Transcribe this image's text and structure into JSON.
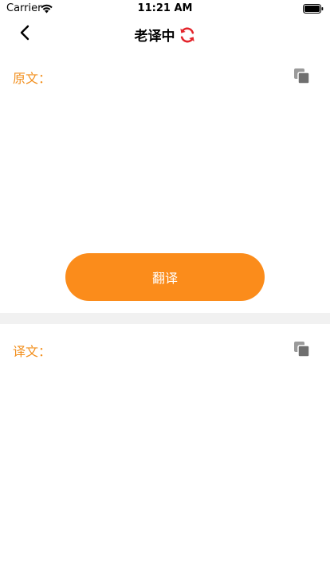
{
  "status_bar": {
    "carrier": "Carrier",
    "time": "11:21 AM"
  },
  "nav": {
    "title": "老译中",
    "refresh_icon_color": "#e3242b"
  },
  "source": {
    "label": "原文：",
    "text": ""
  },
  "translate_button": {
    "label": "翻译",
    "color": "#fb8c1b"
  },
  "result": {
    "label": "译文：",
    "text": ""
  },
  "colors": {
    "accent": "#f2901f",
    "icon_gray": "#7a7a7a",
    "divider": "#f1f1f1"
  }
}
